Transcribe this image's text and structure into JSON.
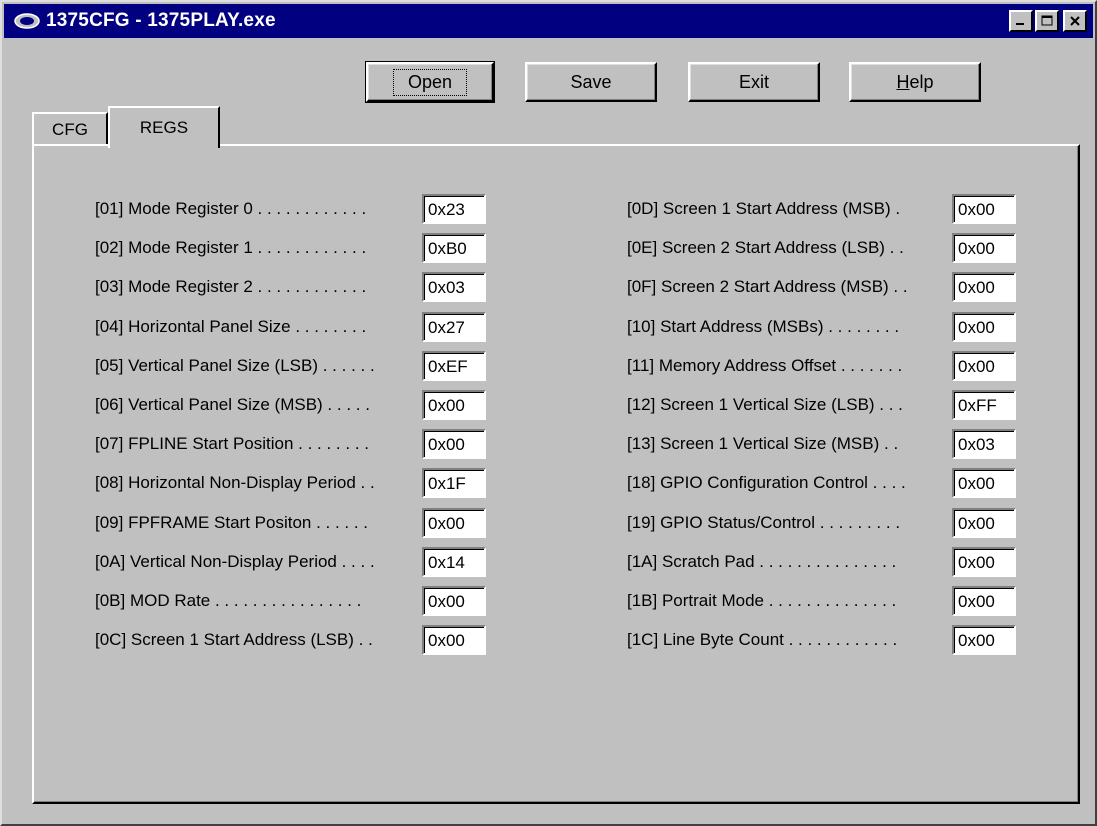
{
  "window": {
    "title": "1375CFG - 1375PLAY.exe"
  },
  "toolbar": {
    "open_label": "Open",
    "save_label": "Save",
    "exit_label": "Exit",
    "help_label": "Help"
  },
  "tabs": [
    {
      "label": "CFG",
      "selected": false
    },
    {
      "label": "REGS",
      "selected": true
    }
  ],
  "registers_left": [
    {
      "label": "[01] Mode Register 0 . . . . . . . . . . . .",
      "value": "0x23"
    },
    {
      "label": "[02] Mode Register 1 . . . . . . . . . . . .",
      "value": "0xB0"
    },
    {
      "label": "[03] Mode Register 2 . . . . . . . . . . . .",
      "value": "0x03"
    },
    {
      "label": "[04] Horizontal Panel Size . . . . . . . .",
      "value": "0x27"
    },
    {
      "label": "[05] Vertical Panel Size (LSB) . . . . . .",
      "value": "0xEF"
    },
    {
      "label": "[06] Vertical Panel Size (MSB) . . . . .",
      "value": "0x00"
    },
    {
      "label": "[07] FPLINE Start Position . . . . . . . .",
      "value": "0x00"
    },
    {
      "label": "[08] Horizontal Non-Display Period . .",
      "value": "0x1F"
    },
    {
      "label": "[09] FPFRAME Start Positon . . . . . .",
      "value": "0x00"
    },
    {
      "label": "[0A] Vertical Non-Display Period . . . .",
      "value": "0x14"
    },
    {
      "label": "[0B] MOD Rate . . . . . . . . . . . . . . . .",
      "value": "0x00"
    },
    {
      "label": "[0C] Screen 1 Start Address (LSB) . .",
      "value": "0x00"
    }
  ],
  "registers_right": [
    {
      "label": "[0D] Screen 1 Start Address (MSB) .",
      "value": "0x00"
    },
    {
      "label": "[0E] Screen 2 Start Address (LSB) . .",
      "value": "0x00"
    },
    {
      "label": "[0F] Screen 2 Start Address (MSB) . .",
      "value": "0x00"
    },
    {
      "label": "[10] Start Address (MSBs) . . . . . . . .",
      "value": "0x00"
    },
    {
      "label": "[11] Memory Address Offset . . . . . . .",
      "value": "0x00"
    },
    {
      "label": "[12] Screen 1 Vertical Size (LSB) . . .",
      "value": "0xFF"
    },
    {
      "label": "[13] Screen 1 Vertical Size (MSB) . .",
      "value": "0x03"
    },
    {
      "label": "[18] GPIO Configuration Control . . . .",
      "value": "0x00"
    },
    {
      "label": "[19] GPIO Status/Control . . . . . . . . .",
      "value": "0x00"
    },
    {
      "label": "[1A] Scratch Pad . . . . . . . . . . . . . . .",
      "value": "0x00"
    },
    {
      "label": "[1B] Portrait Mode . . . . . . . . . . . . . .",
      "value": "0x00"
    },
    {
      "label": "[1C] Line Byte Count . . . . . . . . . . . .",
      "value": "0x00"
    }
  ],
  "colors": {
    "titlebar": "#000080",
    "face": "#c0c0c0",
    "field": "#ffffff"
  }
}
